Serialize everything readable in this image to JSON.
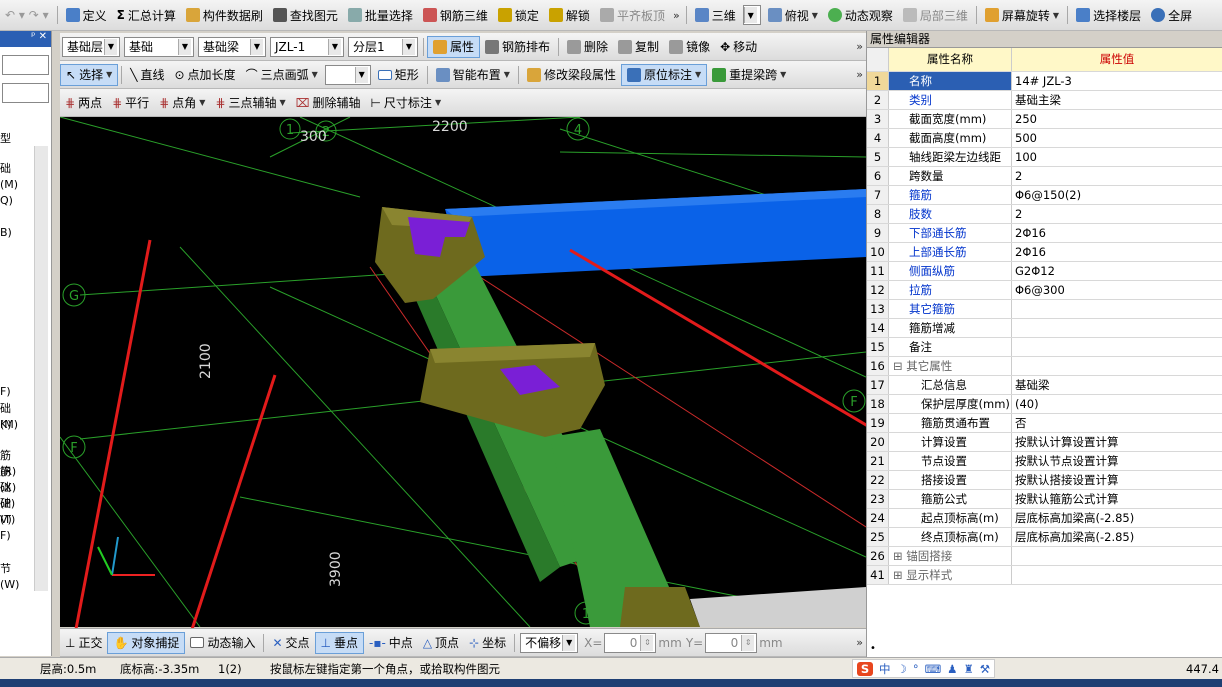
{
  "toolbar1": {
    "items": [
      "定义",
      "汇总计算",
      "构件数据刷",
      "查找图元",
      "批量选择",
      "钢筋三维",
      "锁定",
      "解锁",
      "平齐板顶"
    ],
    "sum_prefix": "Σ",
    "right_items": [
      "三维",
      "俯视",
      "动态观察",
      "局部三维",
      "屏幕旋转",
      "选择楼层",
      "全屏"
    ]
  },
  "toolbar2": {
    "layer": "基础层",
    "category": "基础",
    "type": "基础梁",
    "component": "JZL-1",
    "sublayer": "分层1",
    "buttons": [
      "属性",
      "钢筋排布",
      "删除",
      "复制",
      "镜像",
      "移动"
    ]
  },
  "toolbar3": {
    "items": [
      "选择",
      "直线",
      "点加长度",
      "三点画弧",
      "矩形",
      "智能布置",
      "修改梁段属性",
      "原位标注",
      "重提梁跨"
    ]
  },
  "toolbar4": {
    "items": [
      "两点",
      "平行",
      "点角",
      "三点辅轴",
      "删除辅轴",
      "尺寸标注"
    ]
  },
  "left_panel": {
    "labels": [
      "型",
      "础(M)",
      "Q)",
      "B)",
      "F)",
      "础(M)",
      "K)",
      "筋(R)",
      "筋(X)",
      "础(P)",
      "础(T)",
      "V)",
      "F)",
      "节(W)"
    ]
  },
  "viewport": {
    "dims": [
      "300",
      "2200",
      "2100",
      "3900"
    ],
    "axes": [
      "1",
      "2",
      "4",
      "G",
      "F",
      "F",
      "1"
    ]
  },
  "property_editor": {
    "title": "属性编辑器",
    "col_name": "属性名称",
    "col_value": "属性值",
    "rows": [
      {
        "num": "1",
        "name": "名称",
        "value": "14# JZL-3",
        "style": "blue",
        "indent": 0
      },
      {
        "num": "2",
        "name": "类别",
        "value": "基础主梁",
        "style": "blue",
        "indent": 0
      },
      {
        "num": "3",
        "name": "截面宽度(mm)",
        "value": "250",
        "style": "",
        "indent": 0
      },
      {
        "num": "4",
        "name": "截面高度(mm)",
        "value": "500",
        "style": "",
        "indent": 0
      },
      {
        "num": "5",
        "name": "轴线距梁左边线距",
        "value": "100",
        "style": "",
        "indent": 0
      },
      {
        "num": "6",
        "name": "跨数量",
        "value": "2",
        "style": "",
        "indent": 0
      },
      {
        "num": "7",
        "name": "箍筋",
        "value": "Φ6@150(2)",
        "style": "blue",
        "indent": 0
      },
      {
        "num": "8",
        "name": "肢数",
        "value": "2",
        "style": "blue",
        "indent": 0
      },
      {
        "num": "9",
        "name": "下部通长筋",
        "value": "2Φ16",
        "style": "blue",
        "indent": 0
      },
      {
        "num": "10",
        "name": "上部通长筋",
        "value": "2Φ16",
        "style": "blue",
        "indent": 0
      },
      {
        "num": "11",
        "name": "侧面纵筋",
        "value": "G2Φ12",
        "style": "blue",
        "indent": 0
      },
      {
        "num": "12",
        "name": "拉筋",
        "value": "Φ6@300",
        "style": "blue",
        "indent": 0
      },
      {
        "num": "13",
        "name": "其它箍筋",
        "value": "",
        "style": "blue",
        "indent": 0
      },
      {
        "num": "14",
        "name": "箍筋增减",
        "value": "",
        "style": "",
        "indent": 0
      },
      {
        "num": "15",
        "name": "备注",
        "value": "",
        "style": "",
        "indent": 0
      },
      {
        "num": "16",
        "name": "其它属性",
        "value": "",
        "style": "group",
        "indent": 0
      },
      {
        "num": "17",
        "name": "汇总信息",
        "value": "基础梁",
        "style": "",
        "indent": 1
      },
      {
        "num": "18",
        "name": "保护层厚度(mm)",
        "value": "(40)",
        "style": "",
        "indent": 1
      },
      {
        "num": "19",
        "name": "箍筋贯通布置",
        "value": "否",
        "style": "",
        "indent": 1
      },
      {
        "num": "20",
        "name": "计算设置",
        "value": "按默认计算设置计算",
        "style": "",
        "indent": 1
      },
      {
        "num": "21",
        "name": "节点设置",
        "value": "按默认节点设置计算",
        "style": "",
        "indent": 1
      },
      {
        "num": "22",
        "name": "搭接设置",
        "value": "按默认搭接设置计算",
        "style": "",
        "indent": 1
      },
      {
        "num": "23",
        "name": "箍筋公式",
        "value": "按默认箍筋公式计算",
        "style": "",
        "indent": 1
      },
      {
        "num": "24",
        "name": "起点顶标高(m)",
        "value": "层底标高加梁高(-2.85)",
        "style": "",
        "indent": 1
      },
      {
        "num": "25",
        "name": "终点顶标高(m)",
        "value": "层底标高加梁高(-2.85)",
        "style": "",
        "indent": 1
      },
      {
        "num": "26",
        "name": "锚固搭接",
        "value": "",
        "style": "collapsed",
        "indent": 0
      },
      {
        "num": "41",
        "name": "显示样式",
        "value": "",
        "style": "collapsed",
        "indent": 0
      }
    ]
  },
  "snap_bar": {
    "items": [
      "正交",
      "对象捕捉",
      "动态输入",
      "交点",
      "垂点",
      "中点",
      "顶点",
      "坐标"
    ],
    "offset": "不偏移",
    "x_label": "X=",
    "x_value": "0",
    "y_label": "Y=",
    "y_value": "0",
    "unit": "mm"
  },
  "status_bar": {
    "floor_height": "层高:0.5m",
    "bottom_elev": "底标高:-3.35m",
    "count": "1(2)",
    "prompt": "按鼠标左键指定第一个角点，或拾取构件图元",
    "coord": "447.4"
  },
  "ime": {
    "items": [
      "中",
      "°"
    ]
  },
  "colors": {
    "toolbar_bg": "#dcdcdc",
    "viewport_bg": "#000000",
    "grid_green": "#2aa02a",
    "beam_blue": "#0a62e8",
    "beam_green": "#3a9a3a",
    "cap_olive": "#6e6a1e",
    "column_purple": "#7a1fd6",
    "annotation_red": "#e21b1b",
    "header_yellow": "#fff8c8"
  }
}
